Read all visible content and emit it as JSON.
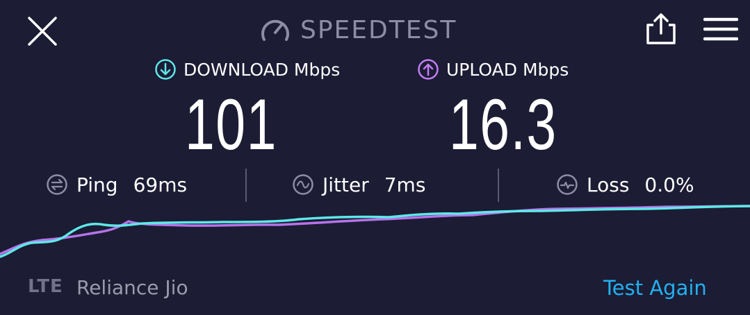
{
  "header": {
    "title": "SPEEDTEST",
    "logo_icon": "speedometer-icon",
    "close_icon": "close-icon",
    "share_icon": "share-icon",
    "menu_icon": "hamburger-menu-icon"
  },
  "download": {
    "label": "DOWNLOAD Mbps",
    "value": "101",
    "icon": "arrow-down-circle-icon",
    "color": "#5ee8e8"
  },
  "upload": {
    "label": "UPLOAD Mbps",
    "value": "16.3",
    "icon": "arrow-up-circle-icon",
    "color": "#c37ef5"
  },
  "stats": {
    "ping": {
      "label": "Ping",
      "value": "69ms",
      "icon": "ping-icon"
    },
    "jitter": {
      "label": "Jitter",
      "value": "7ms",
      "icon": "jitter-icon"
    },
    "loss": {
      "label": "Loss",
      "value": "0.0%",
      "icon": "loss-icon"
    }
  },
  "footer": {
    "connection_type": "LTE",
    "carrier": "Reliance Jio",
    "test_again_label": "Test Again"
  },
  "colors": {
    "background": "#1c1c34",
    "muted_text": "#8d8da6",
    "accent_link": "#22b1f0"
  }
}
